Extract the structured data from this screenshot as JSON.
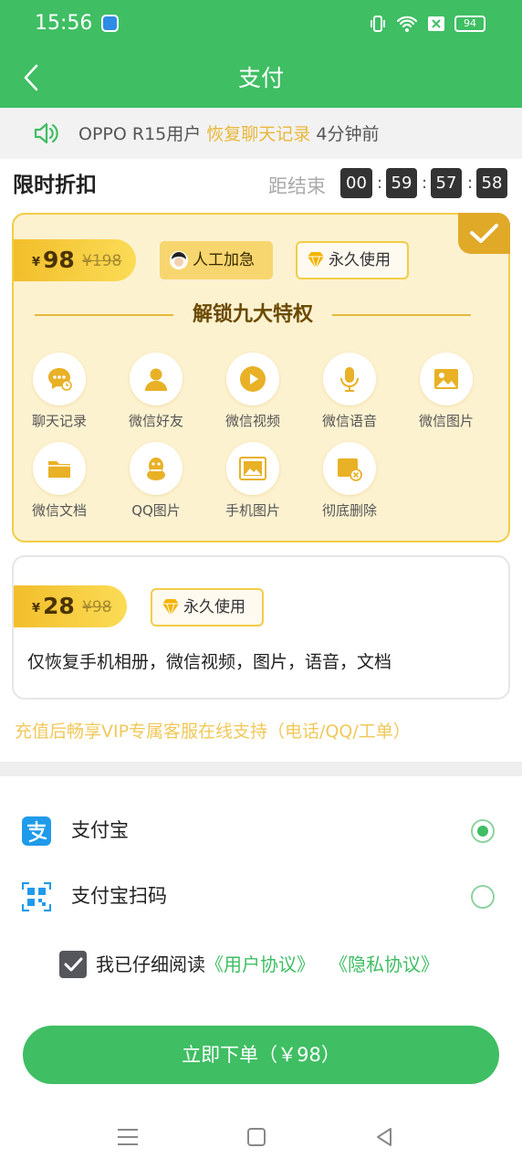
{
  "status_bar": {
    "time": "15:56",
    "battery": "94"
  },
  "header": {
    "title": "支付"
  },
  "notice": {
    "device": "OPPO R15用户",
    "action": "恢复聊天记录",
    "ago": "4分钟前"
  },
  "countdown": {
    "title": "限时折扣",
    "label": "距结束",
    "hh": "00",
    "mm": "59",
    "ss": "57",
    "ms": "58",
    "sep": ":"
  },
  "plan1": {
    "currency": "¥",
    "price": "98",
    "original": "¥198",
    "badge_manual": "人工加急",
    "badge_permanent": "永久使用",
    "privileges_title": "解锁九大特权",
    "features": [
      {
        "label": "聊天记录",
        "icon": "chat-icon"
      },
      {
        "label": "微信好友",
        "icon": "friend-icon"
      },
      {
        "label": "微信视频",
        "icon": "video-play-icon"
      },
      {
        "label": "微信语音",
        "icon": "microphone-icon"
      },
      {
        "label": "微信图片",
        "icon": "image-icon"
      },
      {
        "label": "微信文档",
        "icon": "folder-icon"
      },
      {
        "label": "QQ图片",
        "icon": "qq-penguin-icon"
      },
      {
        "label": "手机图片",
        "icon": "gallery-icon"
      },
      {
        "label": "彻底删除",
        "icon": "delete-file-icon"
      }
    ],
    "selected": true
  },
  "plan2": {
    "currency": "¥",
    "price": "28",
    "original": "¥98",
    "badge_permanent": "永久使用",
    "description": "仅恢复手机相册，微信视频，图片，语音，文档"
  },
  "vip_note": "充值后畅享VIP专属客服在线支持（电话/QQ/工单）",
  "payment": {
    "methods": [
      {
        "label": "支付宝",
        "icon": "alipay-icon",
        "selected": true
      },
      {
        "label": "支付宝扫码",
        "icon": "qr-code-icon",
        "selected": false
      }
    ]
  },
  "agreement": {
    "text": "我已仔细阅读",
    "user_link": "《用户协议》",
    "privacy_link": "《隐私协议》",
    "checked": true
  },
  "order_button": "立即下单（￥98）",
  "colors": {
    "primary": "#3fbe63",
    "gold": "#f1cd47",
    "card_bg": "#fdf2d0",
    "note": "#f0c85a"
  }
}
